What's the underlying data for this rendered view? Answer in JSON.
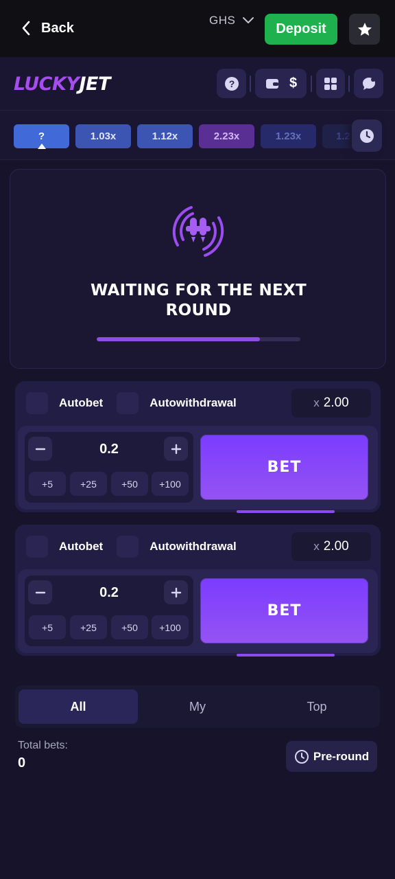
{
  "topbar": {
    "back_label": "Back",
    "currency": "GHS",
    "deposit_label": "Deposit"
  },
  "header": {
    "logo_part1": "LUCKY",
    "logo_part2": "JET",
    "balance_symbol": "$"
  },
  "history": {
    "current": "?",
    "items": [
      "1.03x",
      "1.12x",
      "2.23x",
      "1.23x",
      "1.2"
    ]
  },
  "waiting": {
    "title_line1": "WAITING FOR THE NEXT",
    "title_line2": "ROUND",
    "progress_percent": 80
  },
  "bets": [
    {
      "autobet_label": "Autobet",
      "autowithdrawal_label": "Autowithdrawal",
      "multiplier_prefix": "x",
      "multiplier_value": "2.00",
      "amount": "0.2",
      "quick_amounts": [
        "+5",
        "+25",
        "+50",
        "+100"
      ],
      "bet_label": "BET"
    },
    {
      "autobet_label": "Autobet",
      "autowithdrawal_label": "Autowithdrawal",
      "multiplier_prefix": "x",
      "multiplier_value": "2.00",
      "amount": "0.2",
      "quick_amounts": [
        "+5",
        "+25",
        "+50",
        "+100"
      ],
      "bet_label": "BET"
    }
  ],
  "tabs": {
    "all": "All",
    "my": "My",
    "top": "Top"
  },
  "stats": {
    "total_bets_label": "Total bets:",
    "total_bets_value": "0",
    "preround_label": "Pre-round"
  },
  "colors": {
    "background": "#16132b",
    "deposit_green": "#1fb14e",
    "accent_purple": "#8f4de8",
    "bet_button": "#7b3cff"
  }
}
